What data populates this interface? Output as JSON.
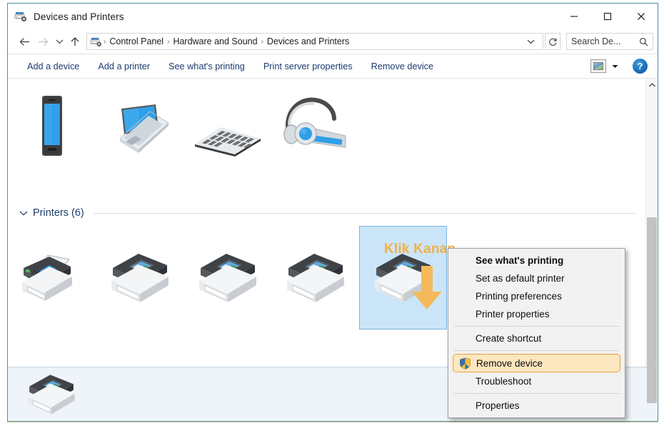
{
  "window": {
    "title": "Devices and Printers",
    "title_icon": "devices-and-printers-icon",
    "minimize_label": "─",
    "maximize_label": "☐",
    "close_label": "✕"
  },
  "address_bar": {
    "back_label": "←",
    "forward_label": "→",
    "recent_label": "∨",
    "up_label": "↑",
    "breadcrumb_icon": "devices-and-printers-icon",
    "crumbs": [
      "Control Panel",
      "Hardware and Sound",
      "Devices and Printers"
    ],
    "separator": "›",
    "dropdown_label": "∨",
    "refresh_label": "↺",
    "search_placeholder": "Search De...",
    "search_value": "",
    "search_icon": "search-icon"
  },
  "command_bar": {
    "items": [
      "Add a device",
      "Add a printer",
      "See what's printing",
      "Print server properties",
      "Remove device"
    ],
    "view_icon": "view-options-icon",
    "view_caret": "▾",
    "help_label": "?"
  },
  "devices": {
    "items": [
      {
        "name": "phone-device-icon",
        "type": "phone"
      },
      {
        "name": "laptop-device-icon",
        "type": "laptop"
      },
      {
        "name": "keyboard-device-icon",
        "type": "keyboard"
      },
      {
        "name": "headset-device-icon",
        "type": "headset"
      }
    ]
  },
  "printers_group": {
    "chevron": "⌄",
    "title": "Printers (6)",
    "items": [
      {
        "name": "printer-fax-icon",
        "type": "fax",
        "selected": false
      },
      {
        "name": "printer-icon-2",
        "type": "printer",
        "selected": false
      },
      {
        "name": "printer-icon-3",
        "type": "printer",
        "selected": false
      },
      {
        "name": "printer-icon-4",
        "type": "printer",
        "selected": false
      },
      {
        "name": "printer-icon-5",
        "type": "printer",
        "selected": true
      }
    ]
  },
  "details_pane": {
    "icon": "printer-icon-selected"
  },
  "annotation": {
    "text": "Klik Kanan",
    "color": "#f2b043",
    "arrow_icon": "down-arrow-icon"
  },
  "context_menu": {
    "items": [
      {
        "label": "See what's printing",
        "bold": true,
        "shield": false,
        "highlighted": false
      },
      {
        "label": "Set as default printer",
        "bold": false,
        "shield": false,
        "highlighted": false
      },
      {
        "label": "Printing preferences",
        "bold": false,
        "shield": false,
        "highlighted": false
      },
      {
        "label": "Printer properties",
        "bold": false,
        "shield": false,
        "highlighted": false
      },
      {
        "separator": true
      },
      {
        "label": "Create shortcut",
        "bold": false,
        "shield": false,
        "highlighted": false
      },
      {
        "separator": true
      },
      {
        "label": "Remove device",
        "bold": false,
        "shield": true,
        "highlighted": true
      },
      {
        "label": "Troubleshoot",
        "bold": false,
        "shield": false,
        "highlighted": false
      },
      {
        "separator": true
      },
      {
        "label": "Properties",
        "bold": false,
        "shield": false,
        "highlighted": false
      }
    ]
  },
  "scrollbar": {
    "up_label": "⌃",
    "down_label": "⌄"
  },
  "colors": {
    "accent_blue": "#1b3b6f",
    "selection_blue": "#cbe5f8",
    "highlight_orange": "#e8a33d",
    "annotation_orange": "#f2b043"
  }
}
